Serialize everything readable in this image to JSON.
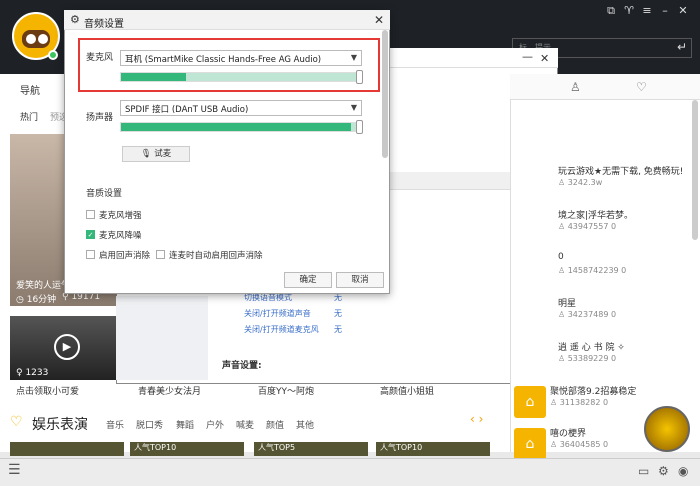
{
  "dialog": {
    "title": "音频设置",
    "mic_label": "麦克风",
    "mic_device": "耳机 (SmartMike Classic Hands-Free AG Audio)",
    "mic_level": 0.27,
    "speaker_label": "扬声器",
    "speaker_device": "SPDIF 接口 (DAnT USB Audio)",
    "speaker_level": 0.96,
    "test_button": "试麦",
    "quality_title": "音质设置",
    "options": [
      {
        "label": "麦克风增强",
        "checked": false
      },
      {
        "label": "麦克风降噪",
        "checked": true
      },
      {
        "label": "启用回声消除",
        "checked": false
      },
      {
        "label": "连麦时自动启用回声消除",
        "checked": false
      }
    ],
    "ok": "确定",
    "cancel": "取消"
  },
  "app": {
    "search_hint": "标…提示…",
    "nav_title": "导航",
    "sub_nav": [
      "热门",
      "预选"
    ],
    "thumb_a_caption": "爱笑的人运气",
    "thumb_a_time": "16分钟",
    "thumb_a_views": "19171",
    "thumb_b_count": "1233",
    "captions": [
      "点击领取小可爱",
      "青春美少女法月",
      "百度YY～阿炮",
      "高颜值小姐姐"
    ],
    "ent_title": "娱乐表演",
    "ent_tabs": [
      "音乐",
      "脱口秀",
      "舞蹈",
      "户外",
      "喊麦",
      "颜值",
      "其他"
    ],
    "ent_thumbs": [
      "人气TOP10",
      "人气TOP5",
      "人气TOP10",
      "人气TOP50"
    ],
    "hotkeys": [
      {
        "name": "切换语音模式",
        "value": "无"
      },
      {
        "name": "关闭/打开频道声音",
        "value": "无"
      },
      {
        "name": "关闭/打开频道麦克风",
        "value": "无"
      }
    ],
    "sound_setting": "声音设置:",
    "right_list": [
      {
        "title": "玩云游戏★无需下载, 免费畅玩!",
        "meta": "3242.3w",
        "meta2": ""
      },
      {
        "title": "境之家|浮华若梦。",
        "meta": "43947557",
        "meta2": "0"
      },
      {
        "title": "0",
        "meta": "1458742239",
        "meta2": "0"
      },
      {
        "title": "明星",
        "meta": "34237489",
        "meta2": "0"
      },
      {
        "title": "逍 遥 心 书 院 ✧",
        "meta": "53389229",
        "meta2": "0"
      },
      {
        "title": "聚悦部落9.2招募稳定",
        "meta": "31138282",
        "meta2": "0"
      },
      {
        "title": "嘻の梗界",
        "meta": "36404585",
        "meta2": "0"
      }
    ]
  }
}
